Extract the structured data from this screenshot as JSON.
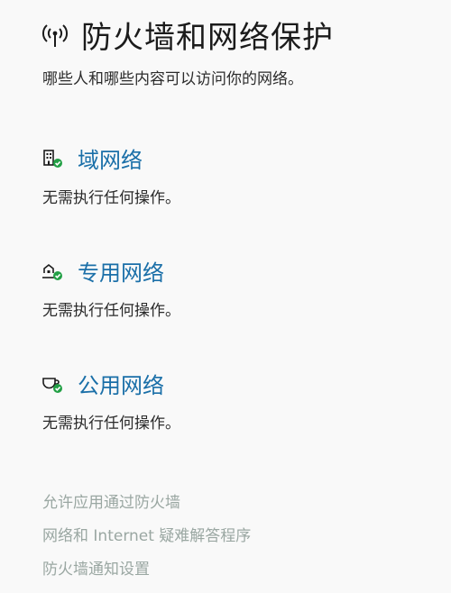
{
  "header": {
    "title": "防火墙和网络保护",
    "subtitle": "哪些人和哪些内容可以访问你的网络。",
    "icon": "antenna-icon"
  },
  "networks": [
    {
      "label": "域网络",
      "status": "无需执行任何操作。",
      "icon": "domain-network-icon"
    },
    {
      "label": "专用网络",
      "status": "无需执行任何操作。",
      "icon": "private-network-icon"
    },
    {
      "label": "公用网络",
      "status": "无需执行任何操作。",
      "icon": "public-network-icon"
    }
  ],
  "links": [
    {
      "label": "允许应用通过防火墙"
    },
    {
      "label": "网络和 Internet 疑难解答程序"
    },
    {
      "label": "防火墙通知设置"
    }
  ],
  "colors": {
    "link_blue": "#1a6fa8",
    "ok_green": "#23a046",
    "muted_link": "#9aa7a2"
  }
}
